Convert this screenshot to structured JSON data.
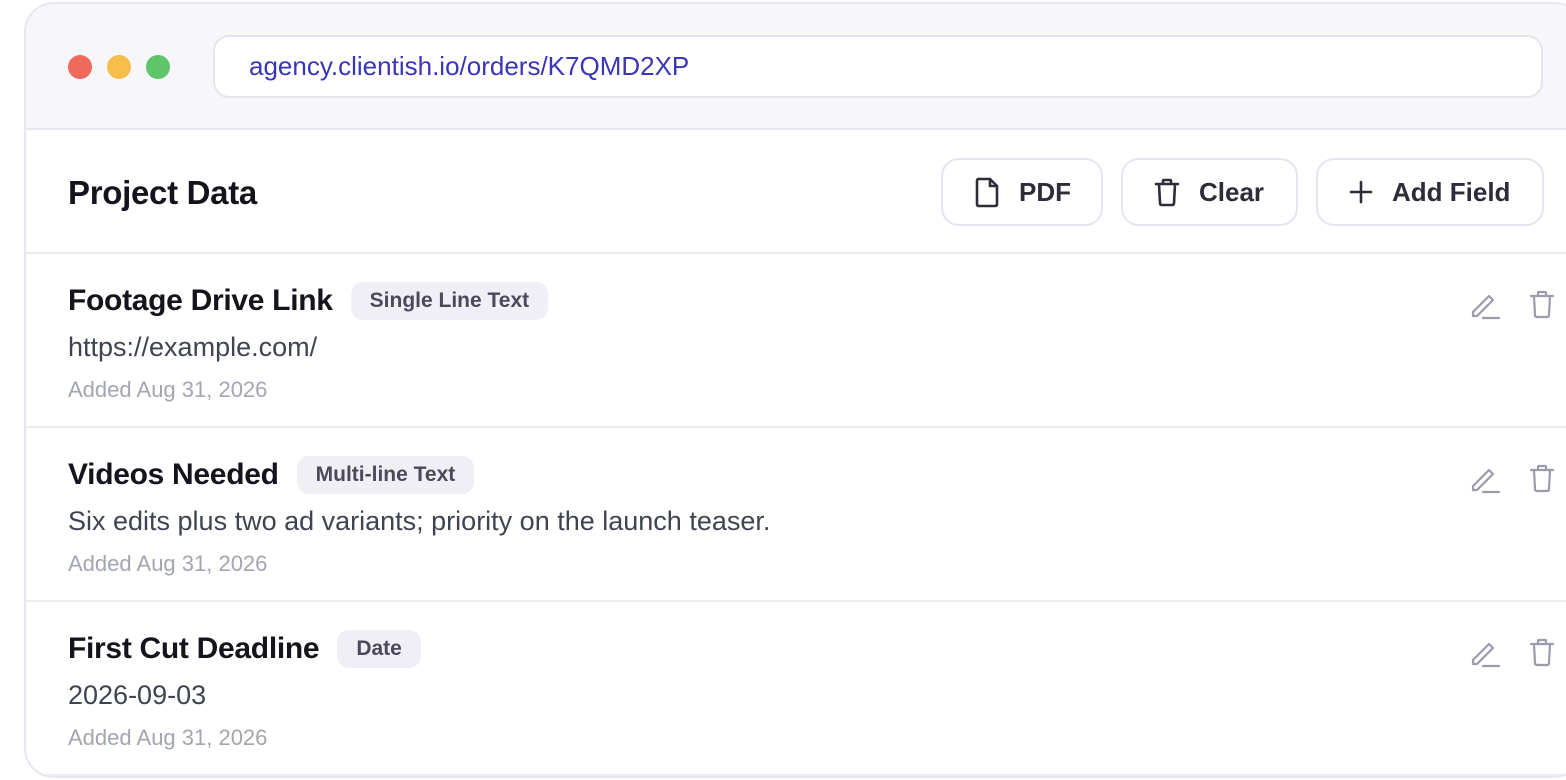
{
  "browser": {
    "url": "agency.clientish.io/orders/K7QMD2XP"
  },
  "header": {
    "title": "Project Data",
    "pdf_label": "PDF",
    "clear_label": "Clear",
    "add_label": "Add Field"
  },
  "fields": [
    {
      "name": "Footage Drive Link",
      "type": "Single Line Text",
      "value": "https://example.com/",
      "added": "Added Aug 31, 2026"
    },
    {
      "name": "Videos Needed",
      "type": "Multi-line Text",
      "value": "Six edits plus two ad variants; priority on the launch teaser.",
      "added": "Added Aug 31, 2026"
    },
    {
      "name": "First Cut Deadline",
      "type": "Date",
      "value": "2026-09-03",
      "added": "Added Aug 31, 2026"
    }
  ],
  "icons": {
    "file": "file-icon",
    "trash": "trash-icon",
    "plus": "plus-icon",
    "edit": "pencil-icon"
  },
  "colors": {
    "url_text": "#3b35b8",
    "close_dot": "#ef6a5d",
    "minimize_dot": "#f6be4b",
    "maximize_dot": "#5ec569"
  }
}
